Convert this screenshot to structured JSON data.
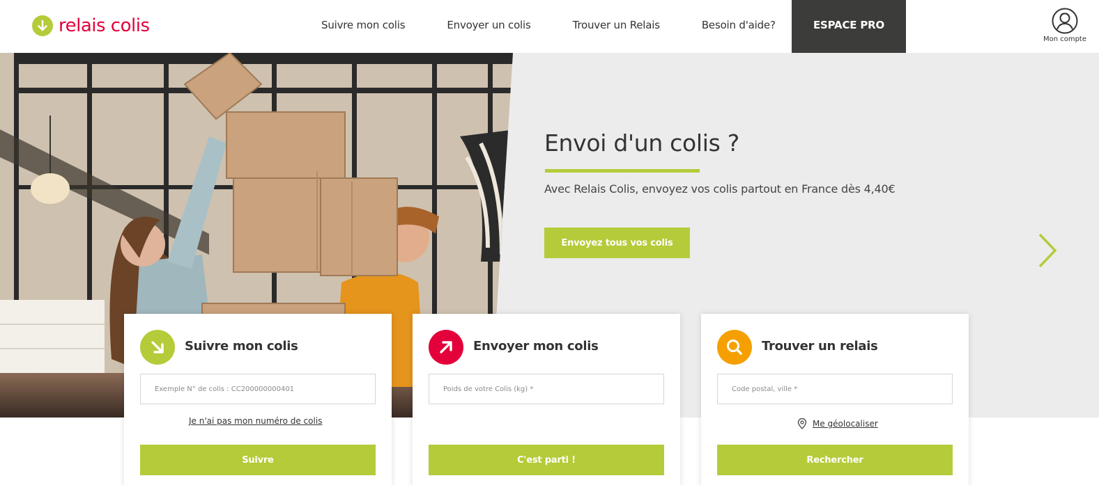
{
  "brand": {
    "name": "relais colis",
    "accent_green": "#b5cb39",
    "brand_red": "#e4003a",
    "dark": "#3c3c3b"
  },
  "header": {
    "logo_icon": "arrow-down-circle-icon",
    "nav": [
      {
        "label": "Suivre mon colis"
      },
      {
        "label": "Envoyer un colis"
      },
      {
        "label": "Trouver un Relais"
      },
      {
        "label": "Besoin d'aide?"
      }
    ],
    "pro_label": "ESPACE PRO",
    "account_label": "Mon compte",
    "account_icon": "user-icon"
  },
  "hero": {
    "title": "Envoi d'un colis ?",
    "subtitle": "Avec Relais Colis, envoyez vos colis partout en France dès 4,40€",
    "cta_label": "Envoyez tous vos colis",
    "next_icon": "chevron-right-icon"
  },
  "cards": [
    {
      "title": "Suivre mon colis",
      "icon": "arrow-down-right-icon",
      "icon_color": "#b5cb39",
      "placeholder": "Exemple N° de colis : CC200000000401",
      "link": "Je n'ai pas mon numéro de colis",
      "button": "Suivre"
    },
    {
      "title": "Envoyer mon colis",
      "icon": "arrow-up-right-icon",
      "icon_color": "#e4003a",
      "placeholder": "Poids de votre Colis (kg) *",
      "button": "C'est parti !"
    },
    {
      "title": "Trouver un relais",
      "icon": "search-icon",
      "icon_color": "#f5a000",
      "placeholder": "Code postal, ville *",
      "link": "Me géolocaliser",
      "link_icon": "location-pin-icon",
      "button": "Rechercher"
    }
  ]
}
